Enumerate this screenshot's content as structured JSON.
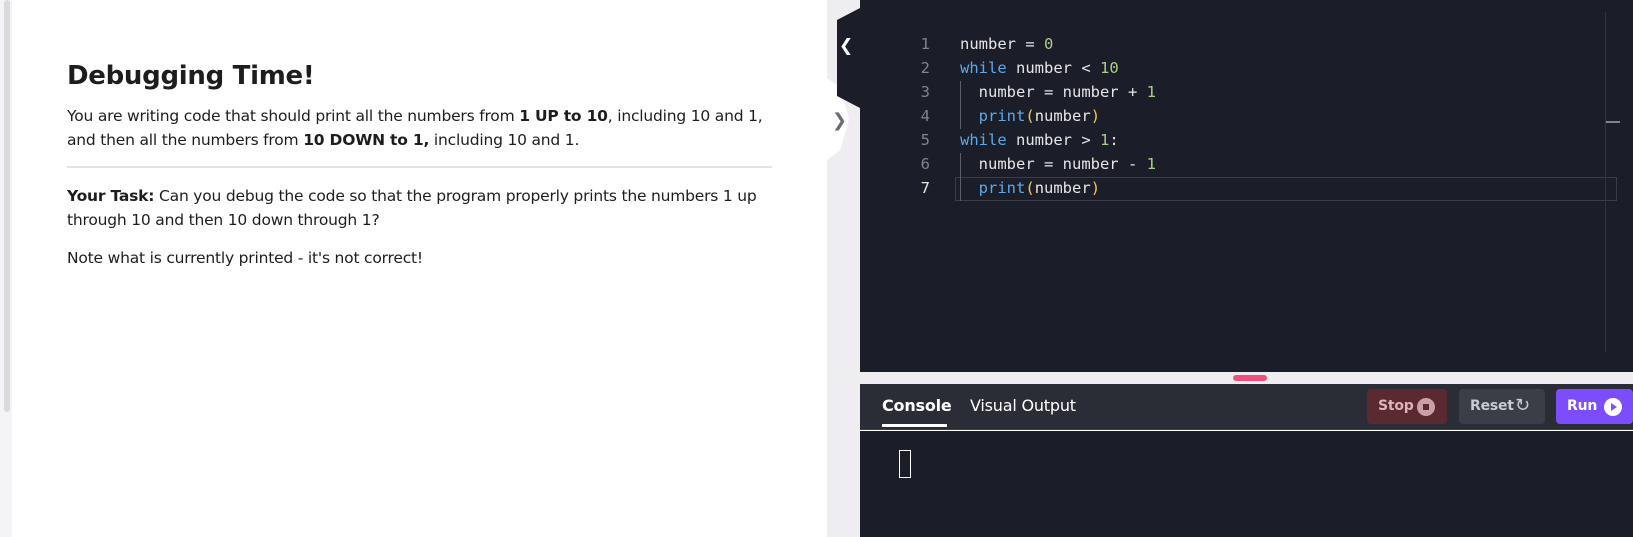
{
  "instructions": {
    "title": "Debugging Time!",
    "p1": {
      "t1": "You are writing code that should print all the numbers from ",
      "b1": "1 UP to 10",
      "t2": ", including 10 and 1, and then all the numbers from ",
      "b2": "10 DOWN to 1,",
      "t3": " including 10 and 1."
    },
    "task": {
      "label": "Your Task:",
      "text": " Can you debug the code so that the program properly prints the numbers 1 up through 10 and then 10 down through 1?"
    },
    "note": "Note what is currently printed - it's not correct!"
  },
  "editor": {
    "lines": [
      {
        "n": "1",
        "parts": [
          {
            "t": "number = ",
            "c": ""
          },
          {
            "t": "0",
            "c": "num"
          }
        ]
      },
      {
        "n": "2",
        "parts": [
          {
            "t": "while",
            "c": "kw"
          },
          {
            "t": " number < ",
            "c": ""
          },
          {
            "t": "10",
            "c": "num"
          }
        ]
      },
      {
        "n": "3",
        "parts": [
          {
            "t": "  number = number + ",
            "c": ""
          },
          {
            "t": "1",
            "c": "num"
          }
        ]
      },
      {
        "n": "4",
        "parts": [
          {
            "t": "  ",
            "c": ""
          },
          {
            "t": "print",
            "c": "fn"
          },
          {
            "t": "(",
            "c": "paren"
          },
          {
            "t": "number",
            "c": ""
          },
          {
            "t": ")",
            "c": "paren"
          }
        ]
      },
      {
        "n": "5",
        "parts": [
          {
            "t": "while",
            "c": "kw"
          },
          {
            "t": " number > ",
            "c": ""
          },
          {
            "t": "1",
            "c": "num"
          },
          {
            "t": ":",
            "c": ""
          }
        ]
      },
      {
        "n": "6",
        "parts": [
          {
            "t": "  number = number - ",
            "c": ""
          },
          {
            "t": "1",
            "c": "num"
          }
        ]
      },
      {
        "n": "7",
        "parts": [
          {
            "t": "  ",
            "c": ""
          },
          {
            "t": "print",
            "c": "fn"
          },
          {
            "t": "(",
            "c": "paren"
          },
          {
            "t": "number",
            "c": ""
          },
          {
            "t": ")",
            "c": "paren"
          }
        ]
      }
    ],
    "active_line": "7"
  },
  "console": {
    "tabs": [
      "Console",
      "Visual Output"
    ],
    "active_tab": "Console",
    "stop_label": "Stop",
    "reset_label": "Reset",
    "run_label": "Run"
  },
  "colors": {
    "editor_bg": "#1b1e28",
    "keyword": "#5fa8e8",
    "number": "#a6d08c",
    "paren": "#f2c94c",
    "run": "#7c4dff",
    "stop": "#5a2a30",
    "resize_handle": "#f0507a"
  },
  "icons": {
    "collapse": "chevron-left-icon",
    "expand": "chevron-right-icon",
    "stop": "stop-circle-icon",
    "reset": "reset-arrows-icon",
    "run": "play-circle-icon"
  }
}
